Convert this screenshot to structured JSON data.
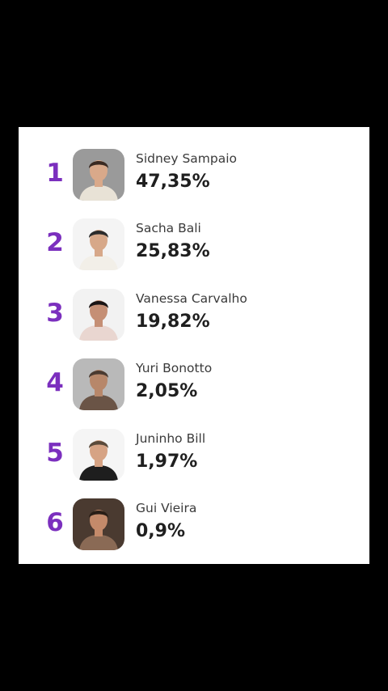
{
  "accent_color": "#7b2fbe",
  "ranking": [
    {
      "rank": "1",
      "name": "Sidney Sampaio",
      "percent": "47,35%",
      "avatar_bg": "#9a9a9a",
      "avatar_skin": "#d9a98a",
      "avatar_hair": "#3a2a22",
      "avatar_shirt": "#e8e2d6"
    },
    {
      "rank": "2",
      "name": "Sacha Bali",
      "percent": "25,83%",
      "avatar_bg": "#f4f4f4",
      "avatar_skin": "#d7a889",
      "avatar_hair": "#2b2b2b",
      "avatar_shirt": "#f2efe8"
    },
    {
      "rank": "3",
      "name": "Vanessa Carvalho",
      "percent": "19,82%",
      "avatar_bg": "#f2f2f2",
      "avatar_skin": "#c58f75",
      "avatar_hair": "#1a1414",
      "avatar_shirt": "#e9d6d0"
    },
    {
      "rank": "4",
      "name": "Yuri Bonotto",
      "percent": "2,05%",
      "avatar_bg": "#b9b9b9",
      "avatar_skin": "#b7876a",
      "avatar_hair": "#4a3a30",
      "avatar_shirt": "#6a5446"
    },
    {
      "rank": "5",
      "name": "Juninho Bill",
      "percent": "1,97%",
      "avatar_bg": "#f5f5f5",
      "avatar_skin": "#d6a384",
      "avatar_hair": "#5a4a3a",
      "avatar_shirt": "#1e1e1e"
    },
    {
      "rank": "6",
      "name": "Gui Vieira",
      "percent": "0,9%",
      "avatar_bg": "#4a3a30",
      "avatar_skin": "#c48a6a",
      "avatar_hair": "#2a1e16",
      "avatar_shirt": "#8a6a55"
    }
  ]
}
